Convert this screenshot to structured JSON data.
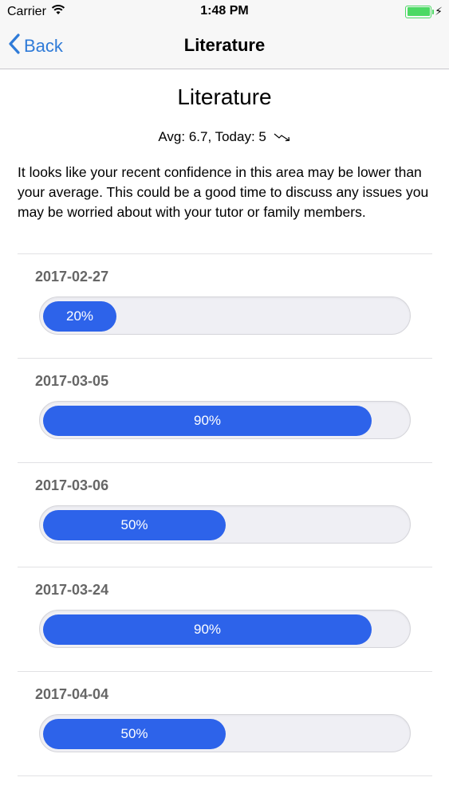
{
  "status_bar": {
    "carrier": "Carrier",
    "time": "1:48 PM",
    "battery_color": "#4cd964",
    "icons": [
      "wifi-icon",
      "battery-icon",
      "charging-icon"
    ]
  },
  "nav": {
    "back_label": "Back",
    "title": "Literature",
    "accent_color": "#2f7bd8"
  },
  "main": {
    "title": "Literature",
    "stats": "Avg: 6.7, Today: 5",
    "trend_icon": "trend-down-icon",
    "message": "It looks like your recent confidence in this area may be lower than your average. This could be a good time to discuss any issues you may be worried about with your tutor or family members."
  },
  "entries": [
    {
      "date": "2017-02-27",
      "percent_label": "20%",
      "value": 0.2
    },
    {
      "date": "2017-03-05",
      "percent_label": "90%",
      "value": 0.9
    },
    {
      "date": "2017-03-06",
      "percent_label": "50%",
      "value": 0.5
    },
    {
      "date": "2017-03-24",
      "percent_label": "90%",
      "value": 0.9
    },
    {
      "date": "2017-04-04",
      "percent_label": "50%",
      "value": 0.5
    }
  ],
  "bar_color": "#2d63ea"
}
